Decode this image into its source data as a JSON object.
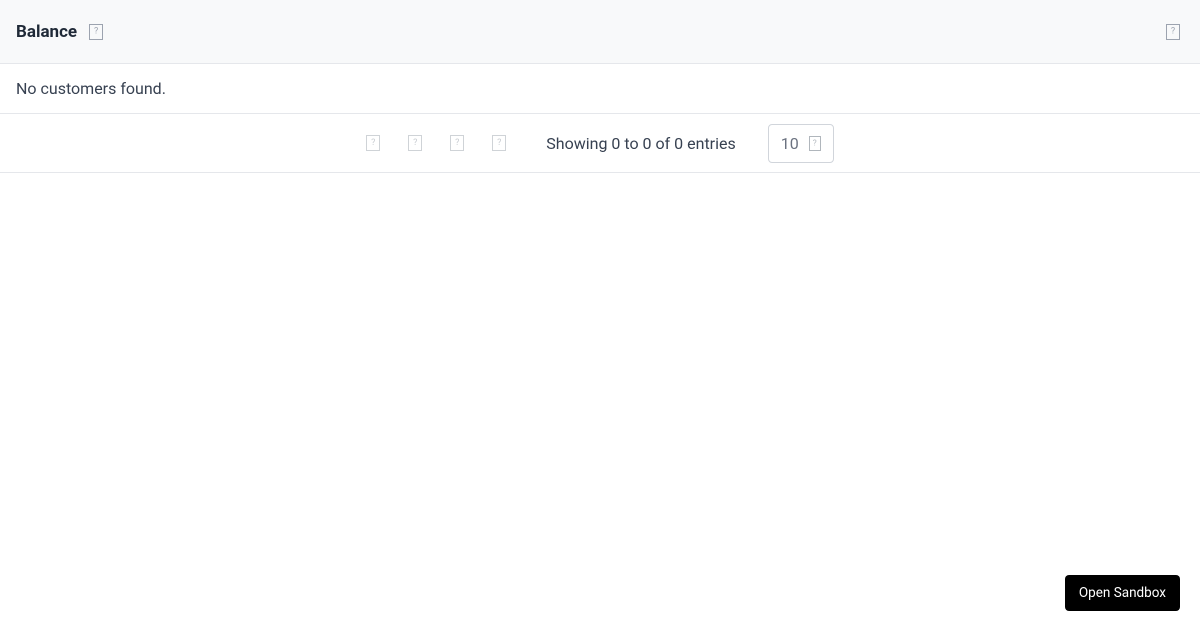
{
  "header": {
    "title": "Balance"
  },
  "empty_message": "No customers found.",
  "pagination": {
    "summary": "Showing 0 to 0 of 0 entries",
    "page_size": "10"
  },
  "actions": {
    "open_sandbox": "Open Sandbox"
  }
}
